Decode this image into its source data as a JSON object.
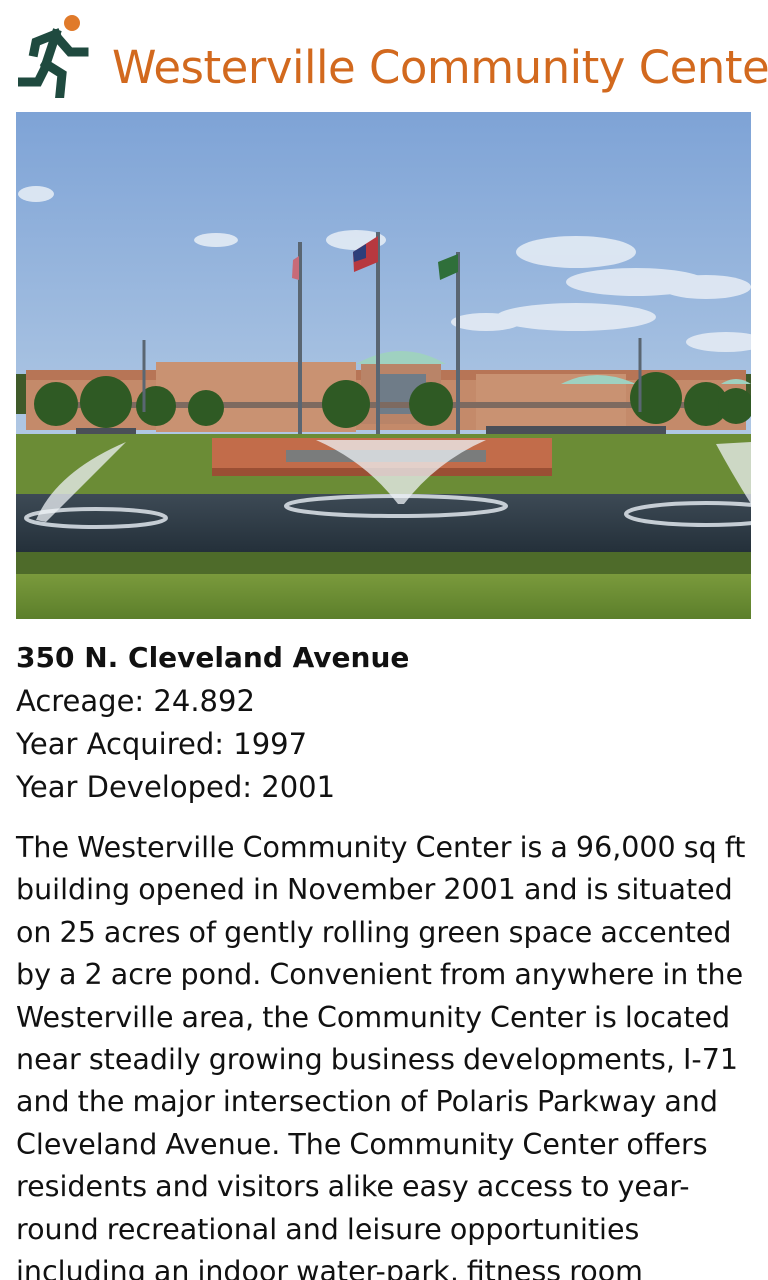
{
  "header": {
    "title": "Westerville Community Center",
    "icon": "running-person-icon",
    "icon_colors": {
      "figure": "#1f4a3f",
      "head": "#e07a2a"
    },
    "title_color": "#d2691e"
  },
  "photo": {
    "subject": "community-center-photo"
  },
  "details": {
    "address": "350 N. Cleveland Avenue",
    "acreage_label": "Acreage:",
    "acreage_value": "24.892",
    "year_acquired_label": "Year Acquired:",
    "year_acquired_value": "1997",
    "year_developed_label": "Year Developed:",
    "year_developed_value": "2001"
  },
  "description": "The Westerville Community Center is a 96,000 sq ft building opened in November 2001 and is situated on 25 acres of gently rolling green space accented by a 2 acre pond. Convenient from anywhere in the Westerville area, the Community Center is located near steadily growing business developments, I-71 and the major intersection of Polaris Parkway and Cleveland Avenue. The Community Center offers residents and visitors alike easy access to year-round recreational and leisure opportunities including an indoor water-park, fitness room"
}
